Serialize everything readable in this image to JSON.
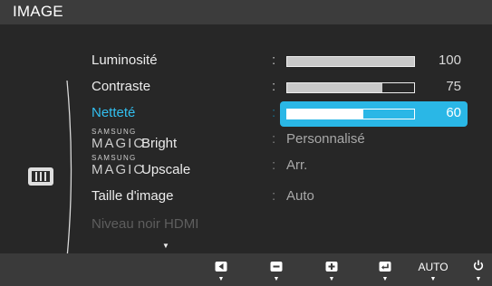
{
  "header": {
    "title": "IMAGE"
  },
  "category": {
    "icon": "monitor-image-icon"
  },
  "menu": {
    "luminosite": {
      "label": "Luminosité",
      "value": 100,
      "level": 1.0
    },
    "contraste": {
      "label": "Contraste",
      "value": 75,
      "level": 0.75
    },
    "nettete": {
      "label": "Netteté",
      "value": 60,
      "level": 0.6,
      "selected": true
    },
    "magic_bright": {
      "brand_top": "SAMSUNG",
      "brand_bottom": "MAGIC",
      "suffix": "Bright",
      "value": "Personnalisé"
    },
    "magic_upscale": {
      "brand_top": "SAMSUNG",
      "brand_bottom": "MAGIC",
      "suffix": "Upscale",
      "value": "Arr."
    },
    "taille": {
      "label": "Taille d'image",
      "value": "Auto"
    },
    "hdmi": {
      "label": "Niveau noir HDMI",
      "disabled": true
    },
    "separator": ":"
  },
  "scroll_indicator": "▼",
  "footer": {
    "buttons": [
      {
        "icon": "left-arrow-icon"
      },
      {
        "icon": "minus-icon"
      },
      {
        "icon": "plus-icon"
      },
      {
        "icon": "enter-icon"
      },
      {
        "label": "AUTO"
      },
      {
        "icon": "power-icon"
      }
    ],
    "arrow": "▼"
  },
  "colors": {
    "highlight": "#2ab7e6",
    "selected_label": "#32bff0",
    "background": "#272727",
    "header": "#3c3c3c",
    "footer": "#3a3a3a"
  }
}
